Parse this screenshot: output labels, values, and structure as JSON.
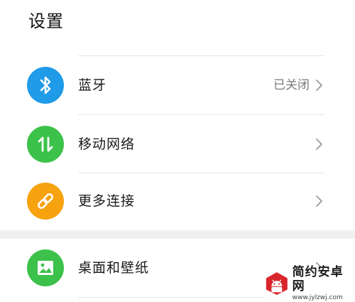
{
  "page": {
    "title": "设置"
  },
  "settings": {
    "items": [
      {
        "label": "蓝牙",
        "value": "已关闭",
        "icon": "bluetooth-icon",
        "color": "#1f9be8"
      },
      {
        "label": "移动网络",
        "value": "",
        "icon": "mobile-data-icon",
        "color": "#3cc24a"
      },
      {
        "label": "更多连接",
        "value": "",
        "icon": "link-icon",
        "color": "#f7a20f"
      },
      {
        "label": "桌面和壁纸",
        "value": "",
        "icon": "image-icon",
        "color": "#3cc24a"
      }
    ]
  },
  "watermark": {
    "title": "简约安卓网",
    "url": "www.jylzwj.com",
    "icon": "android-logo"
  }
}
